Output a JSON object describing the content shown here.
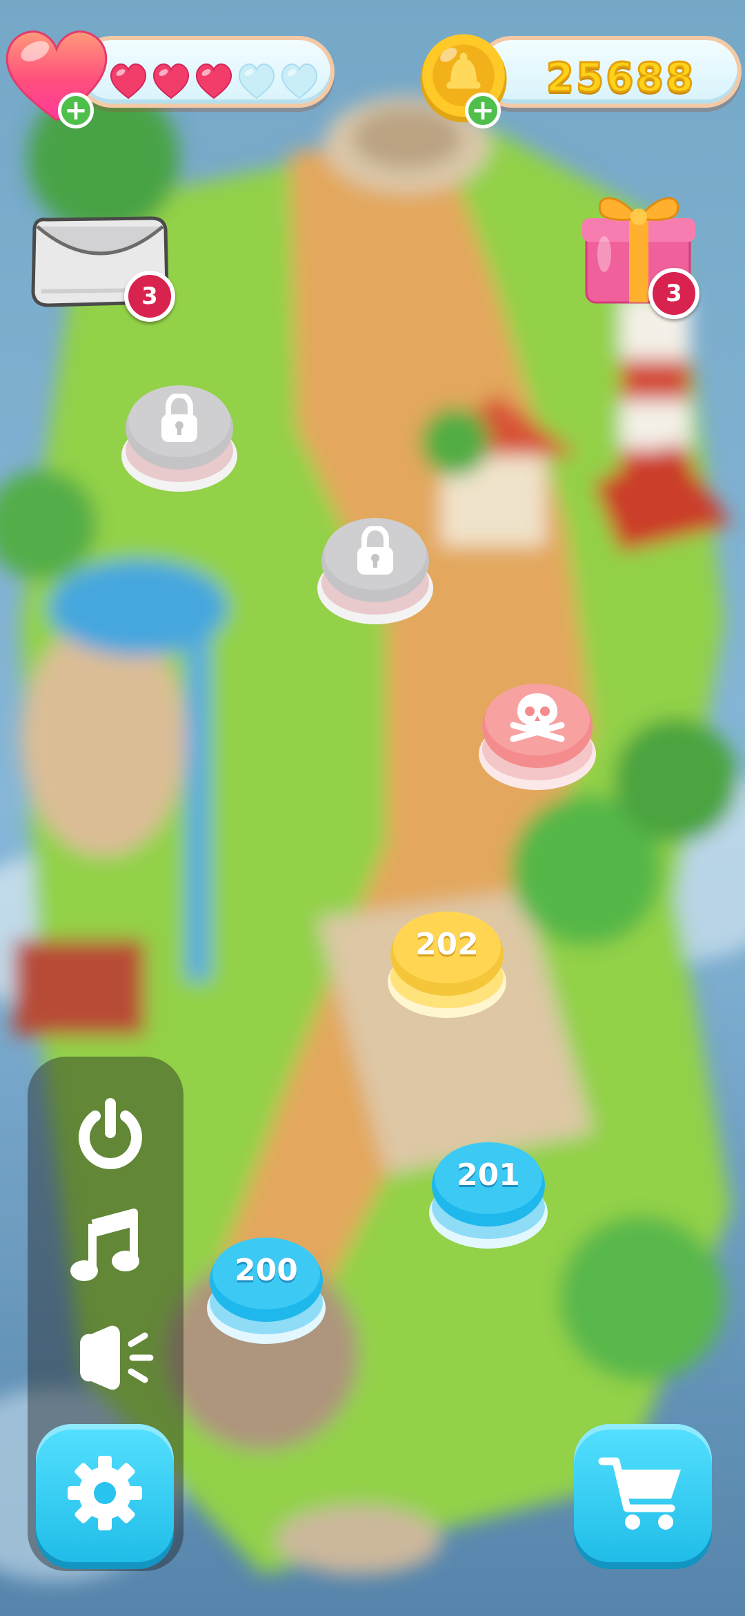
{
  "hud": {
    "lives": {
      "filled": 3,
      "total": 5,
      "icon": "heart-icon",
      "add_icon": "plus-icon"
    },
    "coins": {
      "value": "25688",
      "icon": "coin-icon",
      "add_icon": "plus-icon"
    }
  },
  "mailbox": {
    "icon": "envelope-icon",
    "count": "3"
  },
  "gift": {
    "icon": "gift-icon",
    "count": "3"
  },
  "levels": [
    {
      "state": "locked",
      "icon": "lock-icon"
    },
    {
      "state": "locked",
      "icon": "lock-icon"
    },
    {
      "state": "boss",
      "icon": "skull-icon"
    },
    {
      "state": "current",
      "label": "202"
    },
    {
      "state": "completed",
      "label": "201"
    },
    {
      "state": "completed",
      "label": "200"
    }
  ],
  "side_menu": {
    "items": [
      {
        "icon": "power-icon"
      },
      {
        "icon": "music-note-icon"
      },
      {
        "icon": "sound-icon"
      }
    ],
    "settings_icon": "gear-icon"
  },
  "shop": {
    "icon": "cart-icon"
  },
  "colors": {
    "accent_blue": "#2ec8f3",
    "badge_red": "#d8234f",
    "coin_gold": "#ffd21a",
    "plus_green": "#4fbf4b"
  }
}
